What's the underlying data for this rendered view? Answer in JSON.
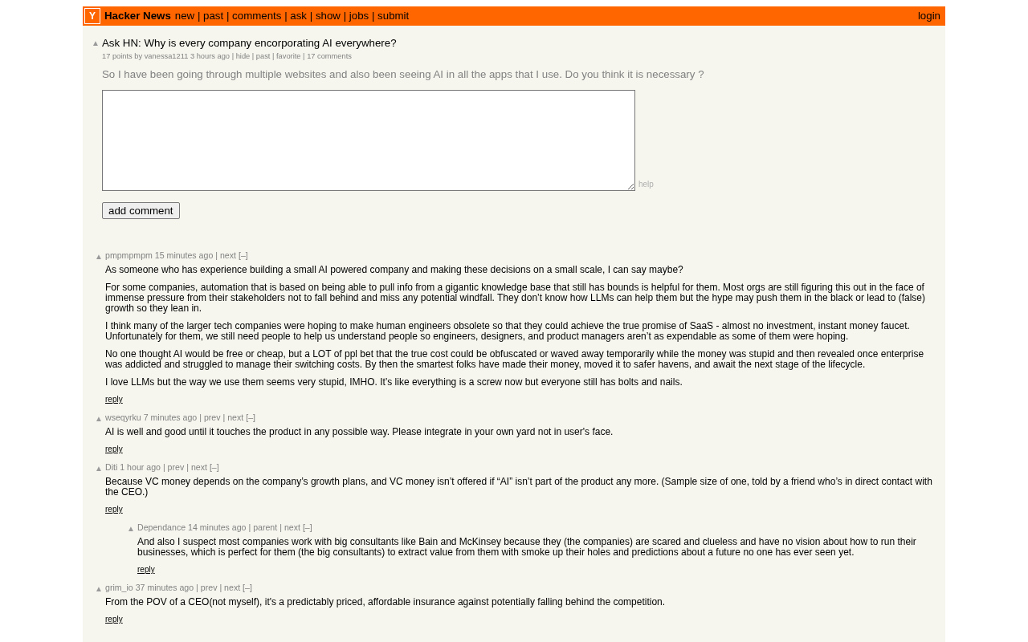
{
  "header": {
    "logo": "Y",
    "site_name": "Hacker News",
    "nav": [
      "new",
      "past",
      "comments",
      "ask",
      "show",
      "jobs",
      "submit"
    ],
    "login": "login"
  },
  "separator": "|",
  "story": {
    "vote": "▲",
    "title": "Ask HN: Why is every company encorporating AI everywhere?",
    "byline": "17 points by vanessa1211 3 hours ago",
    "links": [
      "hide",
      "past",
      "favorite",
      "17 comments"
    ],
    "text": "So I have been going through multiple websites and also been seeing AI in all the apps that I use. Do you think it is necessary ?"
  },
  "comment_form": {
    "help": "help",
    "button": "add comment"
  },
  "comments": [
    {
      "vote": "▲",
      "user": "pmpmpmpm",
      "age": "15 minutes ago",
      "links": [
        "next"
      ],
      "toggle": "[–]",
      "paragraphs": [
        "As someone who has experience building a small AI powered company and making these decisions on a small scale, I can say maybe?",
        "For some companies, automation that is based on being able to pull info from a gigantic knowledge base that still has bounds is helpful for them. Most orgs are still figuring this out in the face of immense pressure from their stakeholders not to fall behind and miss any potential windfall. They don’t know how LLMs can help them but the hype may push them in the black or lead to (false) growth so they lean in.",
        "I think many of the larger tech companies were hoping to make human engineers obsolete so that they could achieve the true promise of SaaS - almost no investment, instant money faucet. Unfortunately for them, we still need people to help us understand people so engineers, designers, and product managers aren’t as expendable as some of them were hoping.",
        "No one thought AI would be free or cheap, but a LOT of ppl bet that the true cost could be obfuscated or waved away temporarily while the money was stupid and then revealed once enterprise was addicted and struggled to manage their switching costs. By then the smartest folks have made their money, moved it to safer havens, and await the next stage of the lifecycle.",
        "I love LLMs but the way we use them seems very stupid, IMHO. It’s like everything is a screw now but everyone still has bolts and nails."
      ],
      "reply": "reply"
    },
    {
      "vote": "▲",
      "user": "wseqyrku",
      "age": "7 minutes ago",
      "links": [
        "prev",
        "next"
      ],
      "toggle": "[–]",
      "paragraphs": [
        "AI is well and good until it touches the product in any possible way. Please integrate in your own yard not in user's face."
      ],
      "reply": "reply"
    },
    {
      "vote": "▲",
      "user": "Diti",
      "age": "1 hour ago",
      "links": [
        "prev",
        "next"
      ],
      "toggle": "[–]",
      "paragraphs": [
        "Because VC money depends on the company’s growth plans, and VC money isn’t offered if “AI” isn’t part of the product any more. (Sample size of one, told by a friend who’s in direct contact with the CEO.)"
      ],
      "reply": "reply",
      "children": [
        {
          "vote": "▲",
          "user": "Dependance",
          "age": "14 minutes ago",
          "links": [
            "parent",
            "next"
          ],
          "toggle": "[–]",
          "paragraphs": [
            "And also I suspect most companies work with big consultants like Bain and McKinsey because they (the companies) are scared and clueless and have no vision about how to run their businesses, which is perfect for them (the big consultants) to extract value from them with smoke up their holes and predictions about a future no one has ever seen yet."
          ],
          "reply": "reply"
        }
      ]
    },
    {
      "vote": "▲",
      "user": "grim_io",
      "age": "37 minutes ago",
      "links": [
        "prev",
        "next"
      ],
      "toggle": "[–]",
      "paragraphs": [
        "From the POV of a CEO(not myself), it's a predictably priced, affordable insurance against potentially falling behind the competition."
      ],
      "reply": "reply"
    }
  ]
}
